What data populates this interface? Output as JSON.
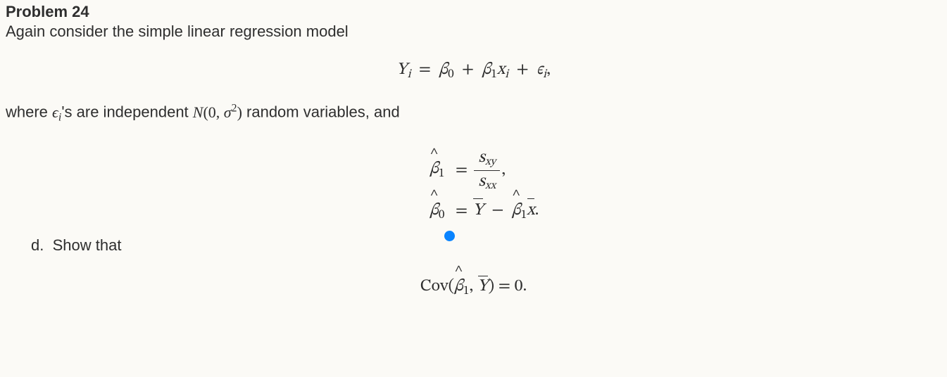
{
  "problem": {
    "label": "Problem 24",
    "intro": "Again consider the simple linear regression model",
    "model_eq": {
      "lhs": "Y",
      "lhs_sub": "i",
      "b0": "β",
      "b0_sub": "0",
      "b1": "β",
      "b1_sub": "1",
      "x": "x",
      "x_sub": "i",
      "eps": "ϵ",
      "eps_sub": "i",
      "trail": ","
    },
    "mid_line": {
      "pre": "where ",
      "eps": "ϵ",
      "eps_sub": "i",
      "post1": "'s are independent ",
      "dist": "N",
      "dist_open": "(0, ",
      "sigma": "σ",
      "sq": "2",
      "dist_close": ")",
      "post2": " random variables, and"
    },
    "estimators": {
      "b1_lhs": "β",
      "b1_lhs_sub": "1",
      "eq": "=",
      "frac_num_s": "s",
      "frac_num_sub": "xy",
      "frac_den_s": "s",
      "frac_den_sub": "xx",
      "trail1": ",",
      "b0_lhs": "β",
      "b0_lhs_sub": "0",
      "ybar": "Y",
      "minus": "−",
      "b1_r": "β",
      "b1_r_sub": "1",
      "xbar": "x",
      "trail2": "."
    },
    "subpart": {
      "label": "d.",
      "text": "Show that"
    },
    "cov": {
      "fn": "Cov",
      "open": "(",
      "arg1": "β",
      "arg1_sub": "1",
      "comma": ", ",
      "arg2": "Y",
      "close": ")",
      "eq": " = 0."
    }
  }
}
